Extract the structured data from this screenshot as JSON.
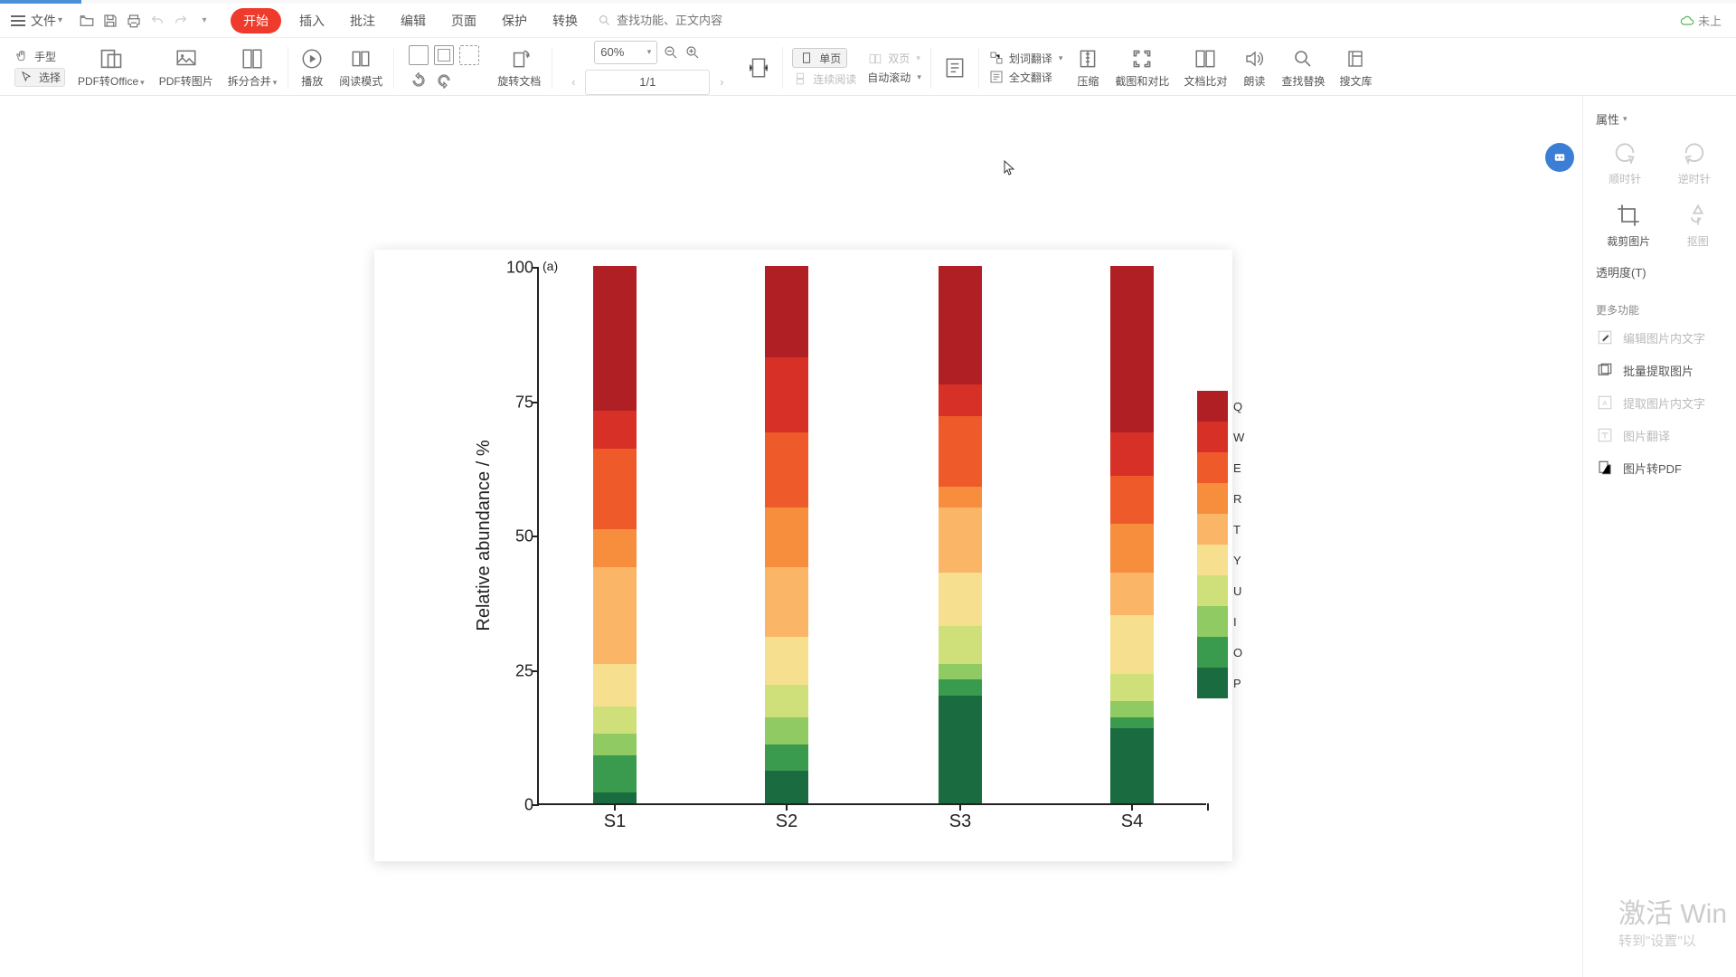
{
  "menubar": {
    "file": "文件",
    "pill": "开始",
    "items": [
      "插入",
      "批注",
      "编辑",
      "页面",
      "保护",
      "转换"
    ],
    "search_placeholder": "查找功能、正文内容",
    "sync": "未上"
  },
  "toolbar": {
    "hand": "手型",
    "select": "选择",
    "pdf_office": "PDF转Office",
    "pdf_image": "PDF转图片",
    "split_merge": "拆分合并",
    "play": "播放",
    "read_mode": "阅读模式",
    "rotate_doc": "旋转文档",
    "zoom_value": "60%",
    "page_value": "1/1",
    "single_page": "单页",
    "double_page": "双页",
    "continuous": "连续阅读",
    "auto_scroll": "自动滚动",
    "word_translate": "划词翻译",
    "full_translate": "全文翻译",
    "compress": "压缩",
    "screenshot_compare": "截图和对比",
    "doc_compare": "文档比对",
    "read_aloud": "朗读",
    "find_replace": "查找替换",
    "search_lib": "搜文库"
  },
  "rpanel": {
    "properties": "属性",
    "cw": "顺时针",
    "ccw": "逆时针",
    "crop": "裁剪图片",
    "cutout": "抠图",
    "transparency": "透明度(T)",
    "more": "更多功能",
    "edit_text_in_image": "编辑图片内文字",
    "batch_extract": "批量提取图片",
    "extract_text": "提取图片内文字",
    "image_translate": "图片翻译",
    "image_to_pdf": "图片转PDF"
  },
  "watermark": {
    "l1": "激活 Win",
    "l2": "转到\"设置\"以"
  },
  "chart_data": {
    "type": "bar",
    "panel": "(a)",
    "ylabel": "Relative abundance / %",
    "ylim": [
      0,
      100
    ],
    "yticks": [
      0,
      25,
      50,
      75,
      100
    ],
    "categories": [
      "S1",
      "S2",
      "S3",
      "S4"
    ],
    "legend_order": [
      "Q",
      "W",
      "E",
      "R",
      "T",
      "Y",
      "U",
      "I",
      "O",
      "P"
    ],
    "colors": {
      "Q": "#b01f24",
      "W": "#d73027",
      "E": "#ef5a2a",
      "R": "#f68e3d",
      "T": "#fbb567",
      "Y": "#f6e08f",
      "U": "#cfe07a",
      "I": "#8fca62",
      "O": "#3a9a4e",
      "P": "#1a6b3f"
    },
    "series": {
      "S1": {
        "Q": 27,
        "W": 7,
        "E": 15,
        "R": 7,
        "T": 18,
        "Y": 8,
        "U": 5,
        "I": 4,
        "O": 7,
        "P": 2
      },
      "S2": {
        "Q": 17,
        "W": 14,
        "E": 14,
        "R": 11,
        "T": 13,
        "Y": 9,
        "U": 6,
        "I": 5,
        "O": 5,
        "P": 6
      },
      "S3": {
        "Q": 22,
        "W": 6,
        "E": 13,
        "R": 4,
        "T": 12,
        "Y": 10,
        "U": 7,
        "I": 3,
        "O": 3,
        "P": 20
      },
      "S4": {
        "Q": 31,
        "W": 8,
        "E": 9,
        "R": 9,
        "T": 8,
        "Y": 11,
        "U": 5,
        "I": 3,
        "O": 2,
        "P": 14
      }
    }
  }
}
